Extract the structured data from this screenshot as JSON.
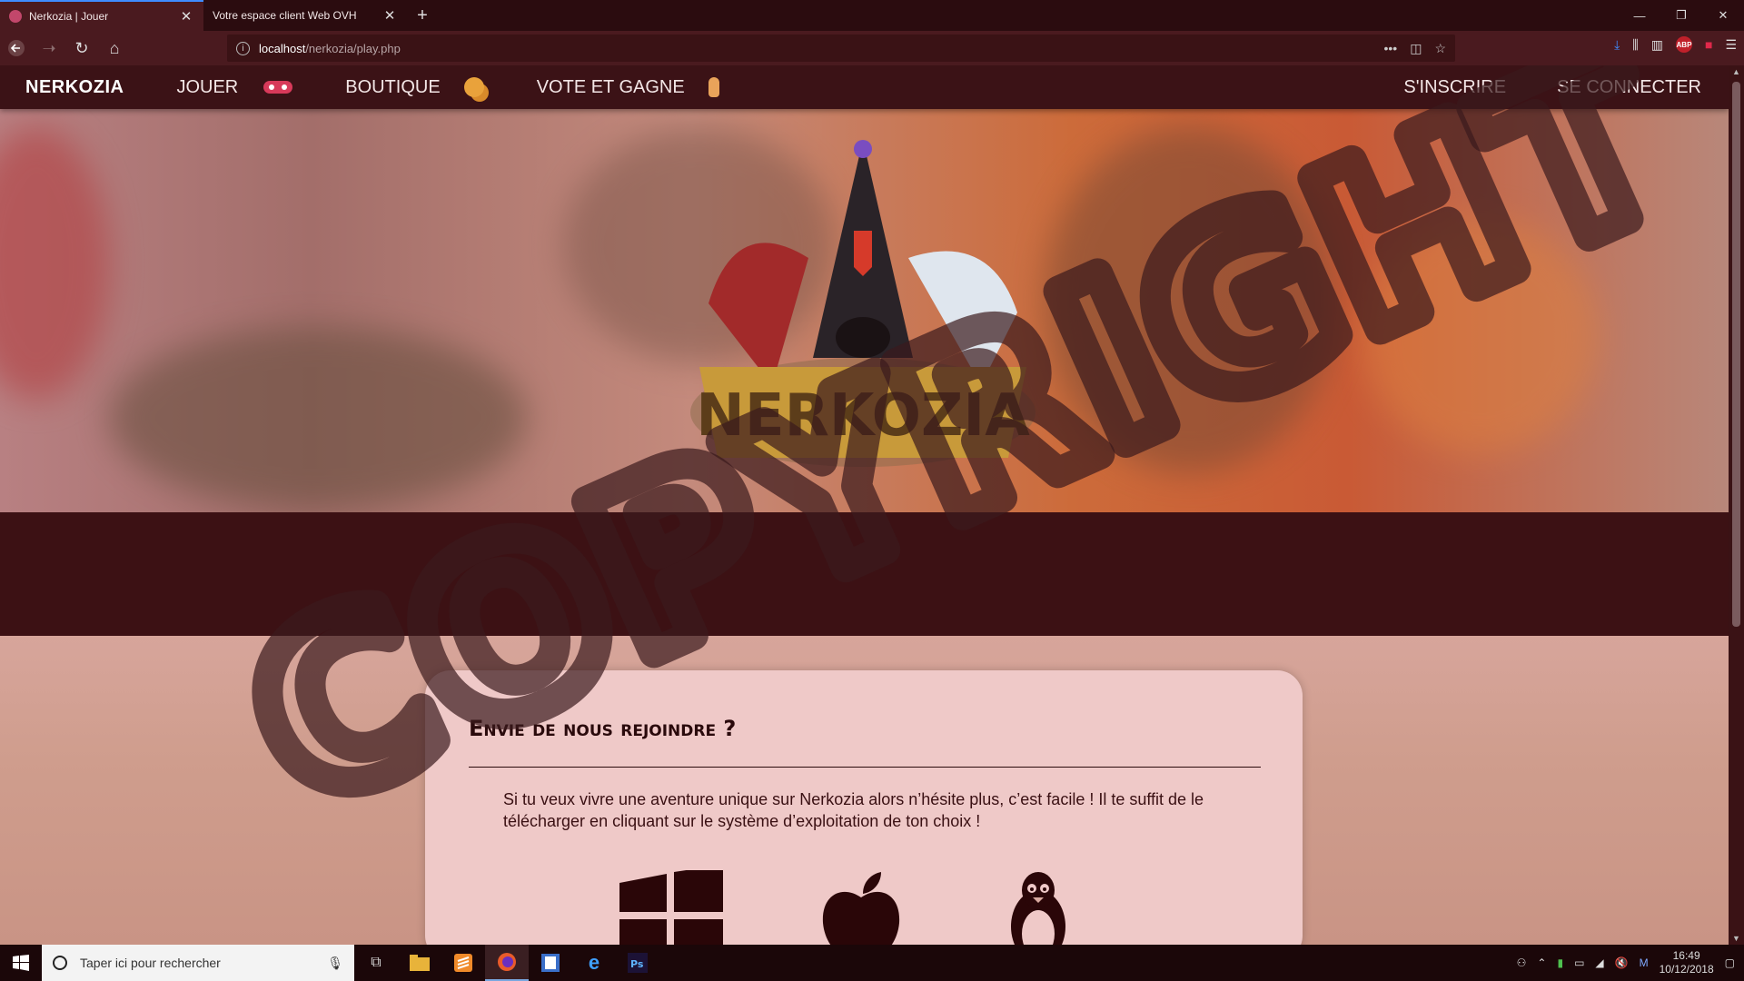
{
  "browser": {
    "tabs": [
      {
        "title": "Nerkozia | Jouer",
        "active": true
      },
      {
        "title": "Votre espace client Web OVH",
        "active": false
      }
    ],
    "url_host": "localhost",
    "url_path": "/nerkozia/play.php"
  },
  "site_nav": {
    "brand": "NERKOZIA",
    "jouer": "JOUER",
    "boutique": "BOUTIQUE",
    "vote": "VOTE ET GAGNE",
    "inscrire": "S'INSCRIRE",
    "connecter": "SE CONNECTER"
  },
  "hero": {
    "logo_text": "NERKOZIA"
  },
  "card": {
    "title": "Envie de nous rejoindre ?",
    "text": "Si tu veux vivre une aventure unique sur Nerkozia alors n’hésite plus, c’est facile ! Il te suffit de le télécharger en cliquant sur le système d’exploitation de ton choix !",
    "os": [
      "windows-icon",
      "apple-icon",
      "linux-icon"
    ]
  },
  "watermark": "COPYRIGHT",
  "taskbar": {
    "search_placeholder": "Taper ici pour rechercher",
    "time": "16:49",
    "date": "10/12/2018"
  },
  "colors": {
    "site_nav_bg": "#3b1216",
    "band_bg": "#3c1114",
    "card_bg": "#efc9c8",
    "accent": "#3f8cff"
  }
}
